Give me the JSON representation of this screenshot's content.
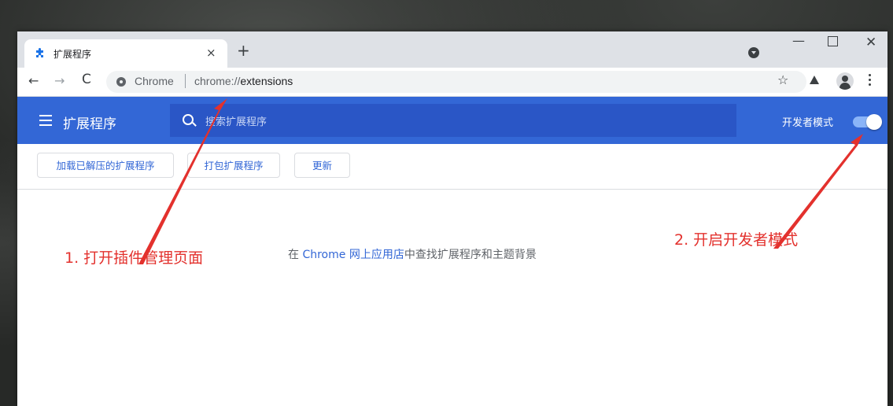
{
  "tab": {
    "title": "扩展程序",
    "close_glyph": "×",
    "newtab_glyph": "+"
  },
  "window_controls": {
    "minimize": "—",
    "close": "✕"
  },
  "toolbar": {
    "back_glyph": "←",
    "forward_glyph": "→",
    "reload_glyph": "C",
    "site_chip": "Chrome",
    "url_protocol": "chrome://",
    "url_path": "extensions",
    "star_glyph": "☆"
  },
  "header": {
    "title": "扩展程序",
    "search_placeholder": "搜索扩展程序",
    "dev_mode_label": "开发者模式",
    "dev_mode_on": true
  },
  "actions": {
    "load_unpacked": "加载已解压的扩展程序",
    "pack": "打包扩展程序",
    "update": "更新"
  },
  "content": {
    "prefix": "在 ",
    "link": "Chrome 网上应用店",
    "suffix": "中查找扩展程序和主题背景"
  },
  "annotations": {
    "step1": "1. 打开插件管理页面",
    "step2": "2. 开启开发者模式",
    "color": "#e3312d"
  },
  "colors": {
    "header_blue": "#3367d6",
    "search_blue": "#2a56c6",
    "toggle_track": "#8ab4f8"
  },
  "icons": [
    "puzzle-icon",
    "search-icon",
    "hamburger-icon",
    "star-icon",
    "labs-icon",
    "profile-icon",
    "more-icon"
  ]
}
